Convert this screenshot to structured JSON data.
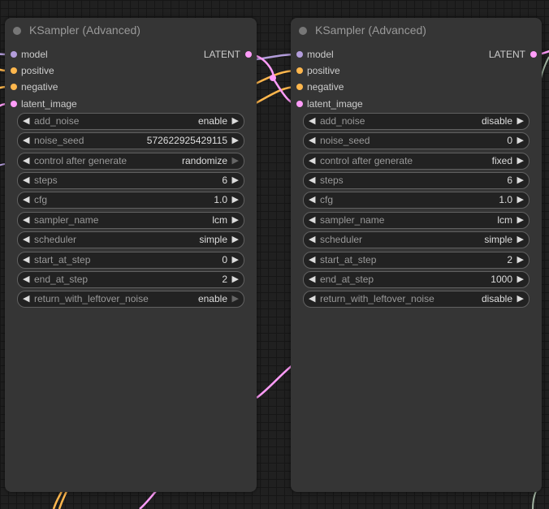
{
  "colors": {
    "model": "#b39ddb",
    "clip": "#ffb74d",
    "latent": "#ff9cf9",
    "gray_link": "#a0b2a0"
  },
  "nodes": [
    {
      "title": "KSampler (Advanced)",
      "inputs": [
        "model",
        "positive",
        "negative",
        "latent_image"
      ],
      "output": "LATENT",
      "widgets": [
        {
          "name": "add_noise",
          "value": "enable"
        },
        {
          "name": "noise_seed",
          "value": "572622925429115"
        },
        {
          "name": "control after generate",
          "value": "randomize"
        },
        {
          "name": "steps",
          "value": "6"
        },
        {
          "name": "cfg",
          "value": "1.0"
        },
        {
          "name": "sampler_name",
          "value": "lcm"
        },
        {
          "name": "scheduler",
          "value": "simple"
        },
        {
          "name": "start_at_step",
          "value": "0"
        },
        {
          "name": "end_at_step",
          "value": "2"
        },
        {
          "name": "return_with_leftover_noise",
          "value": "enable"
        }
      ]
    },
    {
      "title": "KSampler (Advanced)",
      "inputs": [
        "model",
        "positive",
        "negative",
        "latent_image"
      ],
      "output": "LATENT",
      "widgets": [
        {
          "name": "add_noise",
          "value": "disable"
        },
        {
          "name": "noise_seed",
          "value": "0"
        },
        {
          "name": "control after generate",
          "value": "fixed"
        },
        {
          "name": "steps",
          "value": "6"
        },
        {
          "name": "cfg",
          "value": "1.0"
        },
        {
          "name": "sampler_name",
          "value": "lcm"
        },
        {
          "name": "scheduler",
          "value": "simple"
        },
        {
          "name": "start_at_step",
          "value": "2"
        },
        {
          "name": "end_at_step",
          "value": "1000"
        },
        {
          "name": "return_with_leftover_noise",
          "value": "disable"
        }
      ]
    }
  ]
}
